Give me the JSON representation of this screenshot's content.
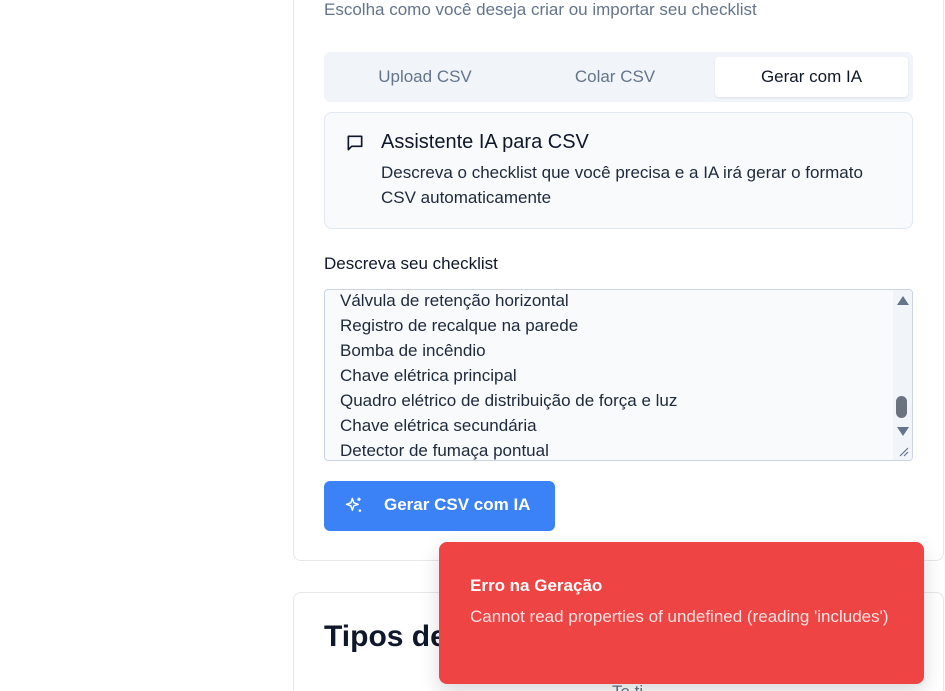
{
  "form": {
    "subtitle": "Escolha como você deseja criar ou importar seu checklist",
    "tabs": [
      {
        "label": "Upload CSV",
        "active": false
      },
      {
        "label": "Colar CSV",
        "active": false
      },
      {
        "label": "Gerar com IA",
        "active": true
      }
    ],
    "info": {
      "icon": "message-square-icon",
      "title": "Assistente IA para CSV",
      "description": "Descreva o checklist que você precisa e a IA irá gerar o formato CSV automaticamente"
    },
    "field_label": "Descreva seu checklist",
    "textarea_lines": [
      "Válvula de retenção horizontal",
      "Registro de recalque na parede",
      "Bomba de incêndio",
      "Chave elétrica principal",
      "Quadro elétrico de distribuição de força e luz",
      "Chave elétrica secundária",
      "Detector de fumaça pontual"
    ],
    "generate_button": {
      "label": "Gerar CSV com IA",
      "icon": "sparkles-icon"
    }
  },
  "section": {
    "title": "Tipos de",
    "faded": "Te                     ti"
  },
  "toast": {
    "title": "Erro na Geração",
    "message": "Cannot read properties of undefined (reading 'includes')"
  },
  "colors": {
    "accent": "#3b82f6",
    "error": "#ef4444"
  }
}
